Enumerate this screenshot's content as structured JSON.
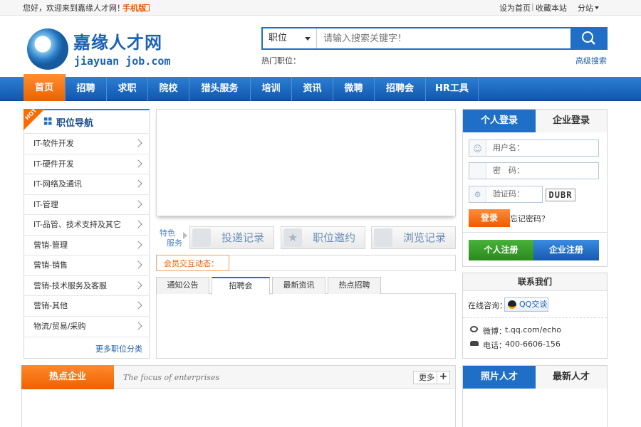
{
  "topbar": {
    "welcome": "您好，欢迎来到嘉缘人才网！",
    "mobile": "手机版",
    "set_home": "设为首页",
    "bookmark": "收藏本站",
    "substation": "分站"
  },
  "logo": {
    "cn": "嘉缘人才网",
    "en": "jiayuan job.com"
  },
  "search": {
    "category": "职位",
    "placeholder": "请输入搜索关键字！",
    "hot_label": "热门职位：",
    "advanced": "高级搜索"
  },
  "nav": [
    "首页",
    "招聘",
    "求职",
    "院校",
    "猎头服务",
    "培训",
    "资讯",
    "微聘",
    "招聘会",
    "HR工具"
  ],
  "job_nav": {
    "badge": "HOT",
    "title": "职位导航",
    "items": [
      "IT-软件开发",
      "IT-硬件开发",
      "IT-网络及通讯",
      "IT-管理",
      "IT-品管、技术支持及其它",
      "营销-管理",
      "营销-销售",
      "营销-技术服务及客服",
      "营销-其他",
      "物流/贸易/采购"
    ],
    "more": "更多职位分类"
  },
  "services": {
    "label_line1": "特色",
    "label_line2": "服务",
    "items": [
      "投递记录",
      "职位邀约",
      "浏览记录"
    ]
  },
  "member_label": "会员交互动态：",
  "info_tabs": {
    "items": [
      "通知公告",
      "招聘会",
      "最新资讯",
      "热点招聘"
    ],
    "active": 1
  },
  "login": {
    "tabs": [
      "个人登录",
      "企业登录"
    ],
    "username": "用户名：",
    "password": "密　码：",
    "captcha": "验证码：",
    "captcha_code": "DUBR",
    "login_btn": "登录",
    "forgot": "忘记密码？",
    "personal_reg": "个人注册",
    "company_reg": "企业注册"
  },
  "contact": {
    "title": "联系我们",
    "online": "在线咨询：",
    "qq": "QQ交谈",
    "weibo_label": "微博：",
    "weibo": "t.qq.com/echo",
    "phone_label": "电话：",
    "phone": "400-6606-156"
  },
  "hot_companies": {
    "title": "热点企业",
    "subtitle": "The focus of enterprises",
    "more": "更多"
  },
  "talent_tabs": [
    "照片人才",
    "最新人才"
  ]
}
